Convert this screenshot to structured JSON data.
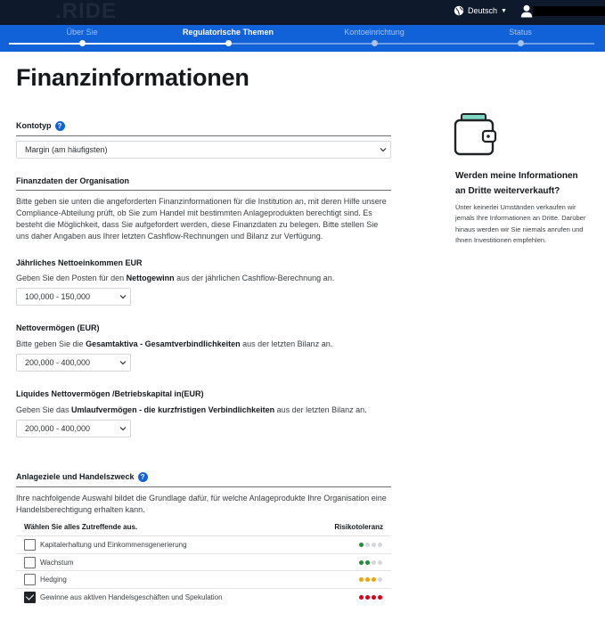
{
  "header": {
    "logo": ".RIDE",
    "language": "Deutsch"
  },
  "steps": [
    {
      "label": "Über Sie"
    },
    {
      "label": "Regulatorische Themen"
    },
    {
      "label": "Kontoeinrichtung"
    },
    {
      "label": "Status"
    }
  ],
  "page": {
    "title": "Finanzinformationen"
  },
  "kontotyp": {
    "label": "Kontotyp",
    "help": "?",
    "value": "Margin (am häufigsten)"
  },
  "finanzdaten": {
    "heading": "Finanzdaten der Organisation",
    "text": "Bitte geben sie unten die angeforderten Finanzinformationen für die Institution an, mit deren Hilfe unsere Compliance-Abteilung prüft, ob Sie zum Handel mit bestimmten Anlageprodukten berechtigt sind. Es besteht die Möglichkeit, dass Sie aufgefordert werden, diese Finanzdaten zu belegen. Bitte stellen Sie uns daher Angaben aus Ihrer letzten Cashflow-Rechnungen und Bilanz zur Verfügung."
  },
  "einkommen": {
    "label": "Jährliches Nettoeinkommen EUR",
    "hint_pre": "Geben Sie den Posten für den ",
    "hint_bold": "Nettogewinn",
    "hint_post": " aus der jährlichen Cashflow-Berechnung an.",
    "value": "100,000 - 150,000"
  },
  "vermoegen": {
    "label": "Nettovermögen (EUR)",
    "hint_pre": "Bitte geben Sie die ",
    "hint_bold": "Gesamtaktiva - Gesamtverbindlichkeiten",
    "hint_post": " aus der letzten Bilanz an.",
    "value": "200,000 - 400,000"
  },
  "liquide": {
    "label": "Liquides Nettovermögen /Betriebskapital in(EUR)",
    "hint_pre": "Geben Sie das ",
    "hint_bold": "Umlaufvermögen - die kurzfristigen Verbindlichkeiten",
    "hint_post": " aus der letzten Bilanz an.",
    "value": "200,000 - 400,000"
  },
  "anlageziele": {
    "label": "Anlageziele und Handelszweck",
    "help": "?",
    "text": "Ihre nachfolgende Auswahl bildet die Grundlage dafür, für welche Anlageprodukte Ihre Organisation eine Handelsberechtigung erhalten kann.",
    "col_select": "Wählen Sie alles Zutreffende aus.",
    "col_risk": "Risikotoleranz",
    "rows": [
      {
        "label": "Kapitalerhaltung und Einkommensgenerierung",
        "checked": false,
        "risk": 1,
        "color": "#1a8f3c"
      },
      {
        "label": "Wachstum",
        "checked": false,
        "risk": 2,
        "color": "#1a8f3c"
      },
      {
        "label": "Hedging",
        "checked": false,
        "risk": 3,
        "color": "#f2a400"
      },
      {
        "label": "Gewinne aus aktiven Handelsgeschäften und Spekulation",
        "checked": true,
        "risk": 4,
        "color": "#d6001c"
      }
    ]
  },
  "side": {
    "title": "Werden meine Informationen an Dritte weiterverkauft?",
    "text": "Unter keinerlei Umständen verkaufen wir jemals Ihre Informationen an Dritte. Darüber hinaus werden wir Sie niemals anrufen und Ihnen Investitionen empfehlen."
  },
  "colors": {
    "topbar": "#0e1a2b",
    "stepbar": "#1162d8",
    "accent": "#1162d8"
  }
}
